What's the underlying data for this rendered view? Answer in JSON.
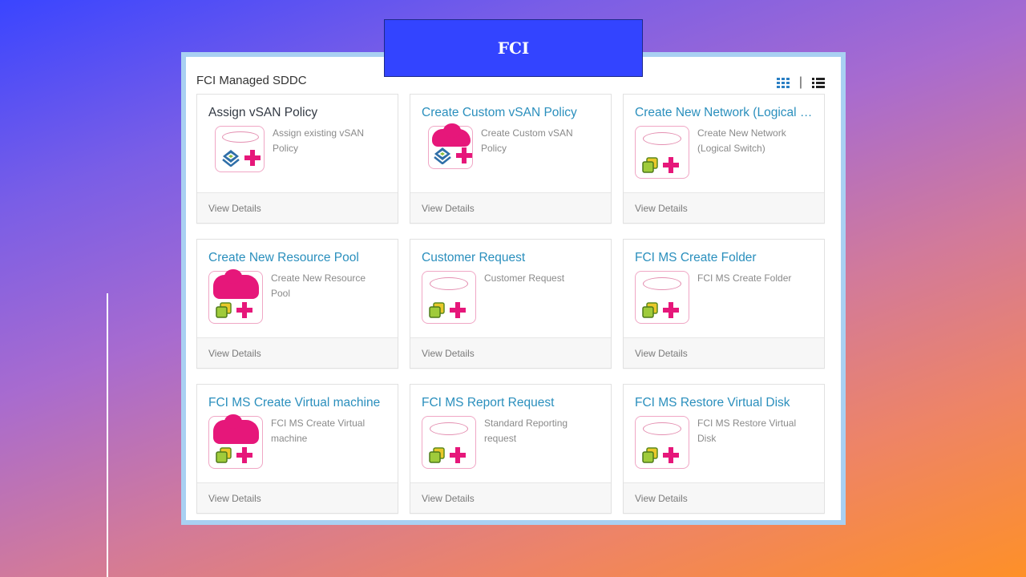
{
  "banner": {
    "title": "FCI"
  },
  "panel": {
    "heading": "FCI Managed SDDC"
  },
  "view_toggle": {
    "separator": "|",
    "grid_icon": "grid-view-icon",
    "list_icon": "list-view-icon"
  },
  "colors": {
    "accent": "#2a8fbd",
    "brand_pink": "#e6177a",
    "banner": "#3344ff",
    "panel_border": "#a9d0f2"
  },
  "cards": [
    {
      "title": "Assign vSAN Policy",
      "description": "Assign existing vSAN Policy",
      "footer": "View Details",
      "icon": "vsan-icon"
    },
    {
      "title": "Create Custom vSAN Policy",
      "description": "Create Custom vSAN Policy",
      "footer": "View Details",
      "icon": "vsan-icon"
    },
    {
      "title": "Create New Network (Logical Switch)",
      "description": "Create New Network (Logical Switch)",
      "footer": "View Details",
      "icon": "vmware-icon"
    },
    {
      "title": "Create New Resource Pool",
      "description": "Create New Resource Pool",
      "footer": "View Details",
      "icon": "vmware-icon"
    },
    {
      "title": "Customer Request",
      "description": "Customer Request",
      "footer": "View Details",
      "icon": "vmware-icon"
    },
    {
      "title": "FCI MS Create Folder",
      "description": "FCI MS Create Folder",
      "footer": "View Details",
      "icon": "vmware-icon"
    },
    {
      "title": "FCI MS Create Virtual machine",
      "description": "FCI MS Create Virtual machine",
      "footer": "View Details",
      "icon": "vmware-icon"
    },
    {
      "title": "FCI MS Report Request",
      "description": "Standard Reporting request",
      "footer": "View Details",
      "icon": "vmware-icon"
    },
    {
      "title": "FCI MS Restore Virtual Disk",
      "description": "FCI MS Restore Virtual Disk",
      "footer": "View Details",
      "icon": "vmware-icon"
    }
  ]
}
